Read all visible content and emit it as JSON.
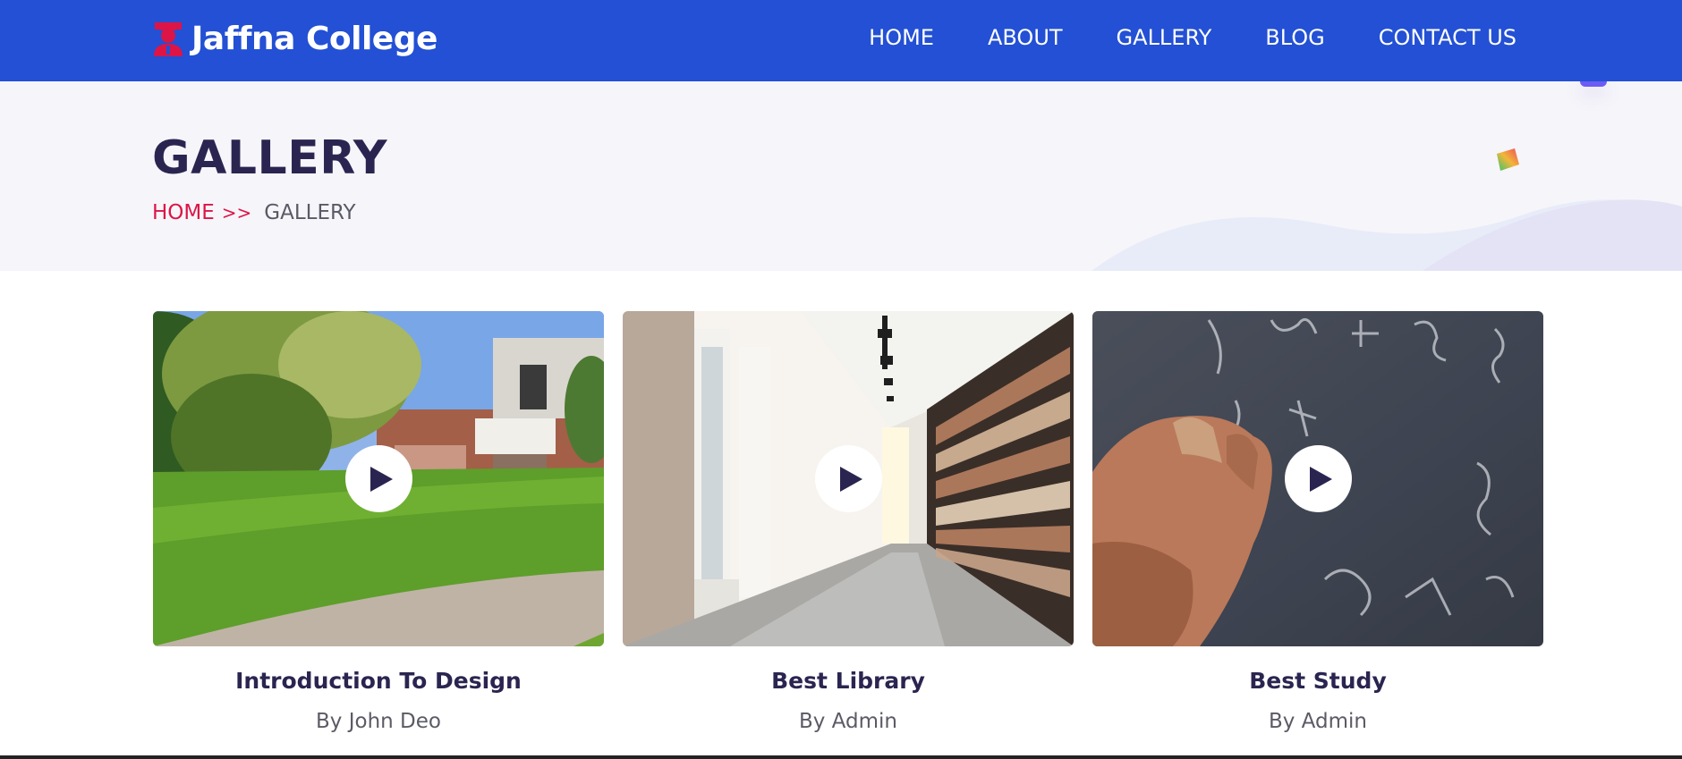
{
  "brand": {
    "name": "Jaffna College",
    "icon": "graduate-icon",
    "color": "#dc1546"
  },
  "nav": {
    "items": [
      {
        "label": "HOME"
      },
      {
        "label": "ABOUT"
      },
      {
        "label": "GALLERY"
      },
      {
        "label": "BLOG"
      },
      {
        "label": "CONTACT US"
      }
    ],
    "background": "#2350d4"
  },
  "banner": {
    "title": "GALLERY",
    "breadcrumb": {
      "home": "HOME",
      "separator": ">>",
      "current": "GALLERY"
    },
    "title_color": "#2a2550",
    "accent_color": "#dc1546"
  },
  "gallery": {
    "cards": [
      {
        "title": "Introduction To Design",
        "author": "By John Deo",
        "scene": "campus-lawn",
        "icon": "play-icon"
      },
      {
        "title": "Best Library",
        "author": "By Admin",
        "scene": "library-aisle",
        "icon": "play-icon"
      },
      {
        "title": "Best Study",
        "author": "By Admin",
        "scene": "chalkboard-hand",
        "icon": "play-icon"
      }
    ]
  }
}
